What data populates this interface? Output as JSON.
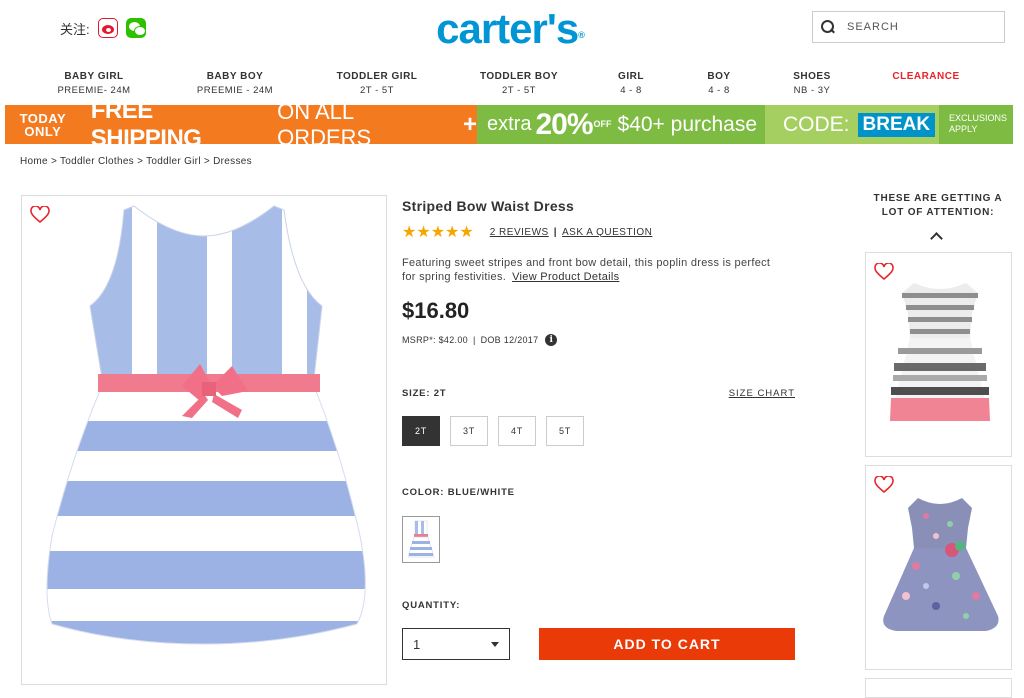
{
  "header": {
    "follow_label": "关注:",
    "logo": "carter's",
    "search_placeholder": "SEARCH"
  },
  "nav": [
    {
      "label": "BABY GIRL",
      "sub": "PREEMIE- 24M"
    },
    {
      "label": "BABY BOY",
      "sub": "PREEMIE - 24M"
    },
    {
      "label": "TODDLER GIRL",
      "sub": "2T - 5T"
    },
    {
      "label": "TODDLER BOY",
      "sub": "2T - 5T"
    },
    {
      "label": "GIRL",
      "sub": "4 - 8"
    },
    {
      "label": "BOY",
      "sub": "4 - 8"
    },
    {
      "label": "SHOES",
      "sub": "NB - 3Y"
    },
    {
      "label": "CLEARANCE",
      "sub": ""
    }
  ],
  "banner": {
    "today": "TODAY",
    "only": "ONLY",
    "free_shipping": "FREE SHIPPING",
    "on_all_orders": "ON ALL ORDERS",
    "plus": "+",
    "extra": "extra",
    "percent": "20%",
    "off": "OFF",
    "amount": "$40+ purchase",
    "code_label": "CODE:",
    "code": "BREAK",
    "exclusions": "EXCLUSIONS",
    "apply": "APPLY"
  },
  "breadcrumb": [
    "Home",
    "Toddler Clothes",
    "Toddler Girl",
    "Dresses"
  ],
  "breadcrumb_sep": " > ",
  "product": {
    "title": "Striped Bow Waist Dress",
    "stars": "★★★★★",
    "rating": 5,
    "reviews_link": "2 REVIEWS",
    "divider": "|",
    "ask_link": "ASK A QUESTION",
    "description": "Featuring sweet stripes and front bow detail, this poplin dress is perfect for spring festivities.",
    "details_link": "View Product Details",
    "price": "$16.80",
    "msrp": "MSRP*: $42.00",
    "msrp_sep": "|",
    "dob": "DOB 12/2017",
    "info_glyph": "i"
  },
  "size": {
    "label": "SIZE: 2T",
    "chart_link": "SIZE CHART",
    "options": [
      "2T",
      "3T",
      "4T",
      "5T"
    ],
    "selected": "2T"
  },
  "color": {
    "label": "COLOR: BLUE/WHITE"
  },
  "quantity": {
    "label": "QUANTITY:",
    "value": "1"
  },
  "cart_button": "ADD TO CART",
  "recommendations": {
    "title": "THESE ARE GETTING A LOT OF ATTENTION:"
  },
  "colors": {
    "brand_blue": "#0096d6",
    "clearance_red": "#e8252a",
    "cart_orange": "#ea3a08",
    "star_gold": "#f7a600",
    "banner_orange": "#f47a20",
    "banner_green": "#7dbb42"
  }
}
